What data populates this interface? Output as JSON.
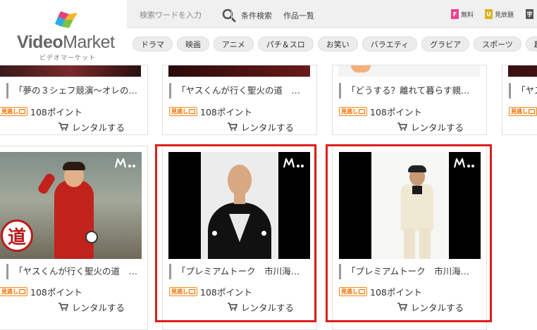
{
  "header": {
    "logo_text_bold": "Video",
    "logo_text_light": "Market",
    "logo_sub": "ビデオマーケット",
    "search_placeholder": "検索ワードを入力",
    "links": [
      "条件検索",
      "作品一覧"
    ],
    "badges": [
      {
        "letter": "F",
        "label": "無料",
        "color": "#e84393"
      },
      {
        "letter": "U",
        "label": "見放題",
        "color": "#d9b31d"
      },
      {
        "letter": "字",
        "label": "",
        "color": "#555555"
      }
    ]
  },
  "genres": [
    "ドラマ",
    "映画",
    "アニメ",
    "パチ＆スロ",
    "お笑い",
    "バラエティ",
    "グラビア",
    "スポーツ",
    "趣味"
  ],
  "cards_row1": [
    {
      "title": "「夢の３シェフ競演～オレの…",
      "badge": "見逃し",
      "points": "108ポイント",
      "rental": "レンタルする"
    },
    {
      "title": "「ヤスくんが行く聖火の道　…",
      "badge": "見逃し",
      "points": "108ポイント",
      "rental": "レンタルする"
    },
    {
      "title": "「どうする？離れて暮らす親…",
      "badge": "見逃し",
      "points": "108ポイント",
      "rental": "レンタルする"
    },
    {
      "title": "「ヤス",
      "badge": "見逃し",
      "points": "",
      "rental": ""
    }
  ],
  "cards_row2": [
    {
      "title": "「ヤスくんが行く聖火の道　…",
      "badge": "見逃し",
      "points": "108ポイント",
      "rental": "レンタルする",
      "overlay_text": "道"
    },
    {
      "title": "「プレミアムトーク　市川海…",
      "badge": "見逃し",
      "points": "108ポイント",
      "rental": "レンタルする"
    },
    {
      "title": "「プレミアムトーク　市川海…",
      "badge": "見逃し",
      "points": "108ポイント",
      "rental": "レンタルする"
    }
  ],
  "colors": {
    "highlight": "#e01d1d",
    "midashi": "#ef6b00"
  }
}
